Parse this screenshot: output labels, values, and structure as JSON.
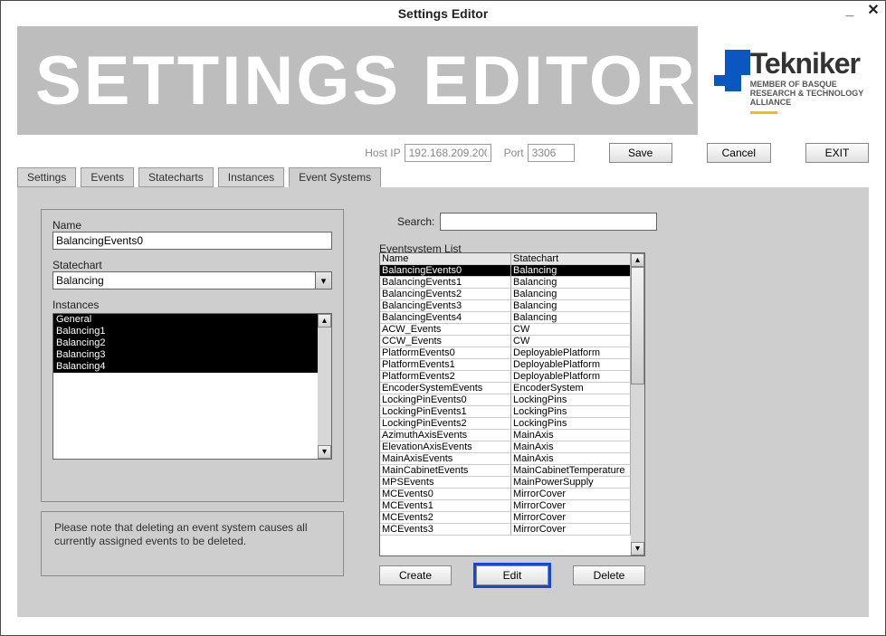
{
  "window_title": "Settings Editor",
  "banner_title": "SETTINGS EDITOR",
  "logo": {
    "name": "Tekniker",
    "tagline": "MEMBER OF BASQUE RESEARCH & TECHNOLOGY ALLIANCE"
  },
  "host_ip": {
    "label": "Host IP",
    "value": "192.168.209.200"
  },
  "port": {
    "label": "Port",
    "value": "3306"
  },
  "toolbar_buttons": {
    "save": "Save",
    "cancel": "Cancel",
    "exit": "EXIT"
  },
  "tabs": {
    "settings": "Settings",
    "events": "Events",
    "statecharts": "Statecharts",
    "instances": "Instances",
    "event_systems": "Event Systems"
  },
  "active_tab": "event_systems",
  "form": {
    "name_label": "Name",
    "name_value": "BalancingEvents0",
    "statechart_label": "Statechart",
    "statechart_value": "Balancing",
    "instances_label": "Instances",
    "instances": [
      "General",
      "Balancing1",
      "Balancing2",
      "Balancing3",
      "Balancing4"
    ]
  },
  "note": "Please note that deleting an event system causes all currently assigned events to be deleted.",
  "search_label": "Search:",
  "search_value": "",
  "list_label": "Eventsystem List",
  "grid": {
    "columns": [
      "Name",
      "Statechart"
    ],
    "selected_index": 0,
    "rows": [
      {
        "name": "BalancingEvents0",
        "statechart": "Balancing"
      },
      {
        "name": "BalancingEvents1",
        "statechart": "Balancing"
      },
      {
        "name": "BalancingEvents2",
        "statechart": "Balancing"
      },
      {
        "name": "BalancingEvents3",
        "statechart": "Balancing"
      },
      {
        "name": "BalancingEvents4",
        "statechart": "Balancing"
      },
      {
        "name": "ACW_Events",
        "statechart": "CW"
      },
      {
        "name": "CCW_Events",
        "statechart": "CW"
      },
      {
        "name": "PlatformEvents0",
        "statechart": "DeployablePlatform"
      },
      {
        "name": "PlatformEvents1",
        "statechart": "DeployablePlatform"
      },
      {
        "name": "PlatformEvents2",
        "statechart": "DeployablePlatform"
      },
      {
        "name": "EncoderSystemEvents",
        "statechart": "EncoderSystem"
      },
      {
        "name": "LockingPinEvents0",
        "statechart": "LockingPins"
      },
      {
        "name": "LockingPinEvents1",
        "statechart": "LockingPins"
      },
      {
        "name": "LockingPinEvents2",
        "statechart": "LockingPins"
      },
      {
        "name": "AzimuthAxisEvents",
        "statechart": "MainAxis"
      },
      {
        "name": "ElevationAxisEvents",
        "statechart": "MainAxis"
      },
      {
        "name": "MainAxisEvents",
        "statechart": "MainAxis"
      },
      {
        "name": "MainCabinetEvents",
        "statechart": "MainCabinetTemperature"
      },
      {
        "name": "MPSEvents",
        "statechart": "MainPowerSupply"
      },
      {
        "name": "MCEvents0",
        "statechart": "MirrorCover"
      },
      {
        "name": "MCEvents1",
        "statechart": "MirrorCover"
      },
      {
        "name": "MCEvents2",
        "statechart": "MirrorCover"
      },
      {
        "name": "MCEvents3",
        "statechart": "MirrorCover"
      }
    ]
  },
  "actions": {
    "create": "Create",
    "edit": "Edit",
    "delete": "Delete"
  }
}
